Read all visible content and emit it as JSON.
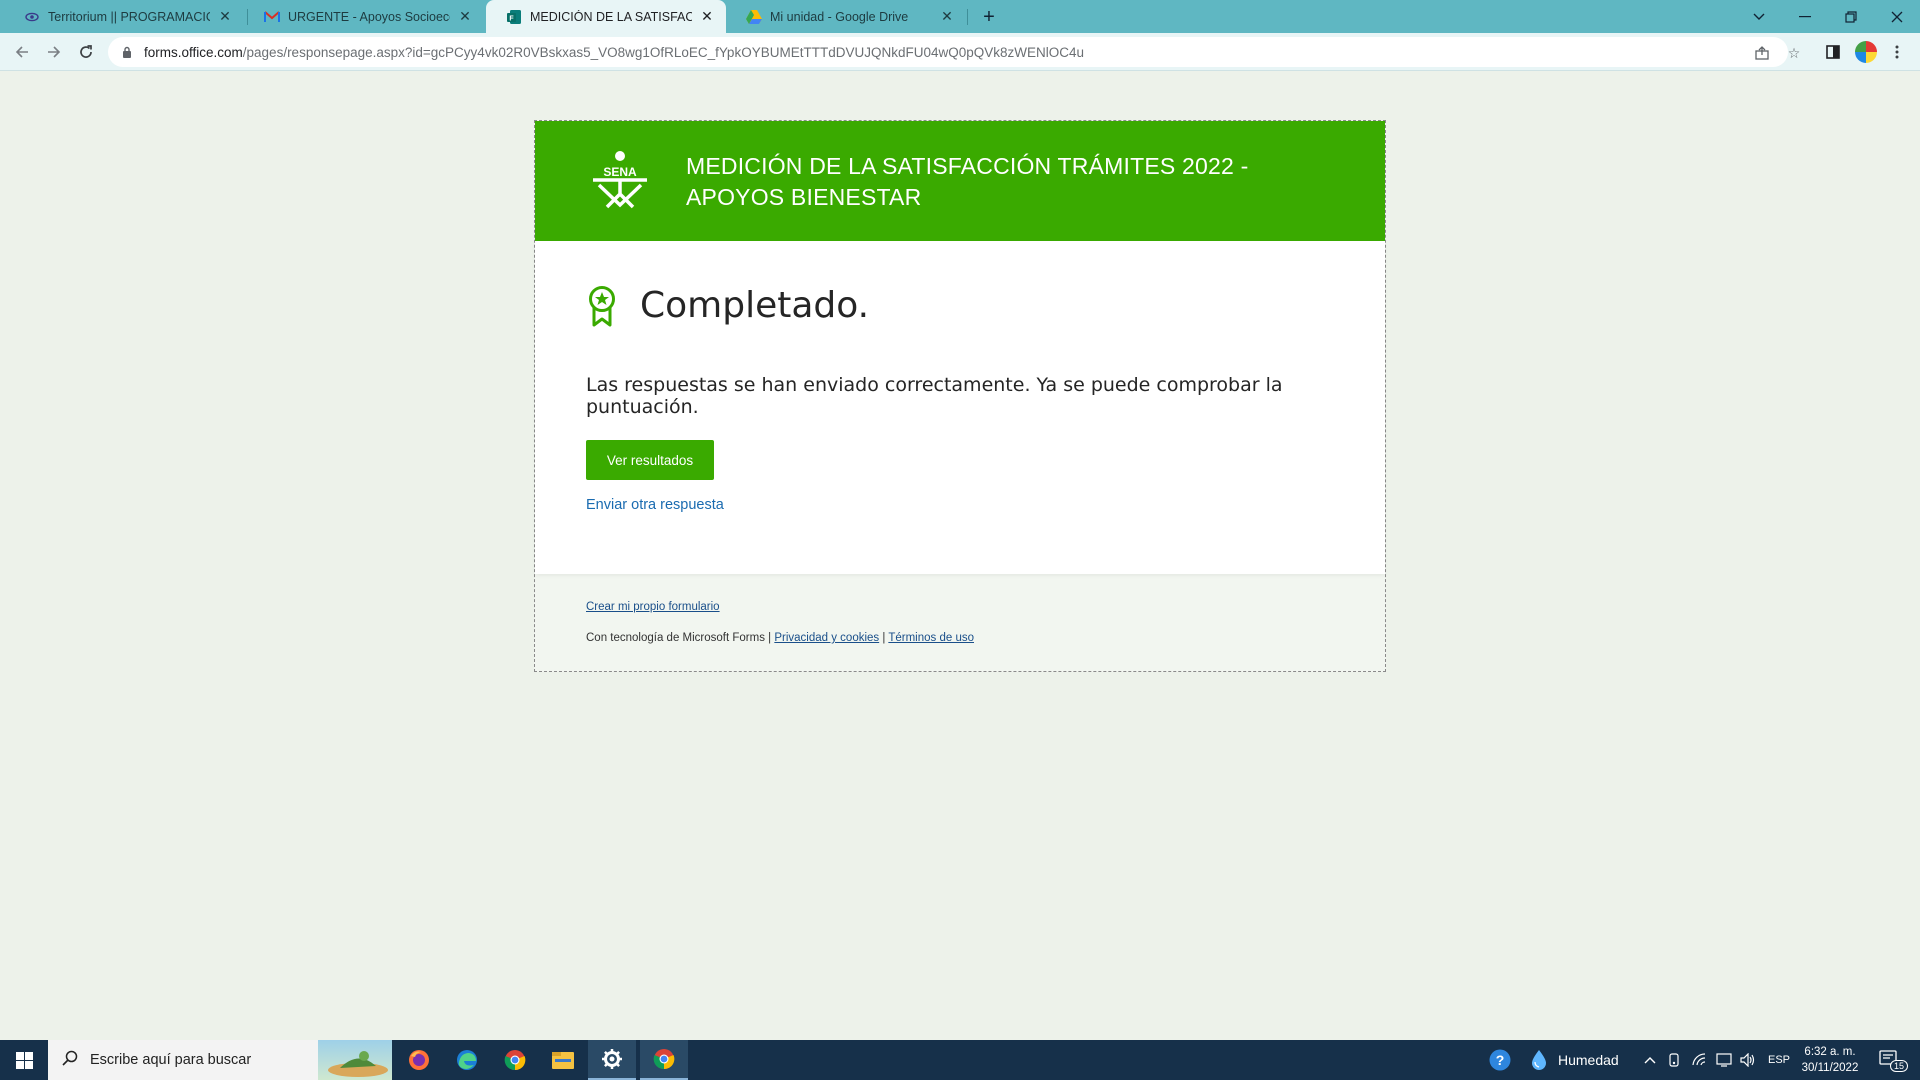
{
  "browser": {
    "tabs": [
      {
        "title": "Territorium || PROGRAMACION D",
        "favicon": "eye-icon"
      },
      {
        "title": "URGENTE - Apoyos Socioecono",
        "favicon": "gmail-icon"
      },
      {
        "title": "MEDICIÓN DE LA SATISFACCIÓN",
        "favicon": "forms-icon"
      },
      {
        "title": "Mi unidad - Google Drive",
        "favicon": "drive-icon"
      }
    ],
    "active_tab": 2,
    "url_host": "forms.office.com",
    "url_path": "/pages/responsepage.aspx?id=gcPCyy4vk02R0VBskxas5_VO8wg1OfRLoEC_fYpkOYBUMEtTTTdDVUJQNkdFU04wQ0pQVk8zWENlOC4u"
  },
  "form": {
    "title": "MEDICIÓN DE LA SATISFACCIÓN TRÁMITES 2022 - APOYOS BIENESTAR",
    "logo_text": "SENA",
    "completed_title": "Completado.",
    "message": "Las respuestas se han enviado correctamente. Ya se puede comprobar la puntuación.",
    "results_button": "Ver resultados",
    "another_response": "Enviar otra respuesta",
    "footer": {
      "create_own": "Crear mi propio formulario",
      "powered_by": "Con tecnología de Microsoft Forms | ",
      "privacy": "Privacidad y cookies",
      "separator": " | ",
      "terms": "Términos de uso"
    }
  },
  "taskbar": {
    "search_placeholder": "Escribe aquí para buscar",
    "weather_label": "Humedad",
    "language": "ESP",
    "time": "6:32 a. m.",
    "date": "30/11/2022",
    "notifications_count": "15"
  },
  "colors": {
    "brand_green": "#3aaa00",
    "tab_strip": "#5fb7c2",
    "link_blue": "#1a6bb0"
  }
}
